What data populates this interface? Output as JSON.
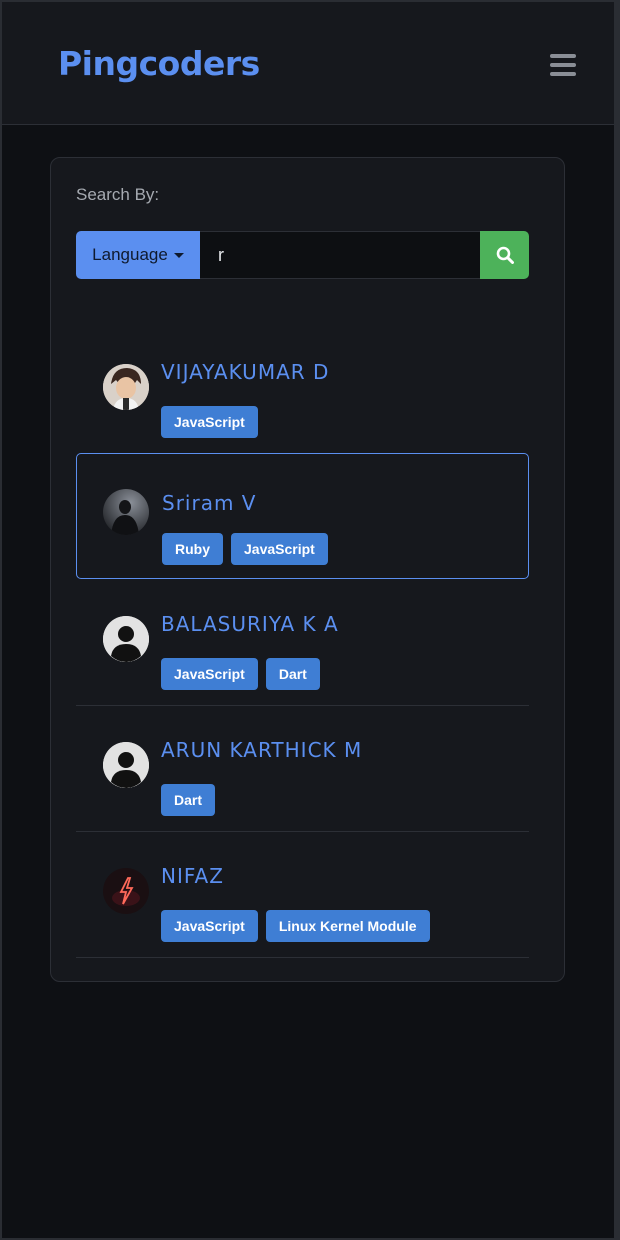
{
  "navbar": {
    "brand": "Pingcoders",
    "menu_icon": "hamburger-menu-icon"
  },
  "search": {
    "label": "Search By:",
    "filter_label": "Language",
    "query": "r",
    "button_icon": "search-icon"
  },
  "colors": {
    "accent": "#5b8ff0",
    "badge": "#3f7ed4",
    "search_button": "#4db25a",
    "background": "#0e1014"
  },
  "users": [
    {
      "name": "VIJAYAKUMAR D",
      "avatar": "cartoon-avatar",
      "languages": [
        "JavaScript"
      ]
    },
    {
      "name": "Sriram V",
      "avatar": "photo-avatar",
      "languages": [
        "Ruby",
        "JavaScript"
      ]
    },
    {
      "name": "BALASURIYA K A",
      "avatar": "default-user-avatar",
      "languages": [
        "JavaScript",
        "Dart"
      ]
    },
    {
      "name": "ARUN KARTHICK M",
      "avatar": "default-user-avatar",
      "languages": [
        "Dart"
      ]
    },
    {
      "name": "NIFAZ",
      "avatar": "neon-bolt-avatar",
      "languages": [
        "JavaScript",
        "Linux Kernel Module"
      ]
    }
  ]
}
